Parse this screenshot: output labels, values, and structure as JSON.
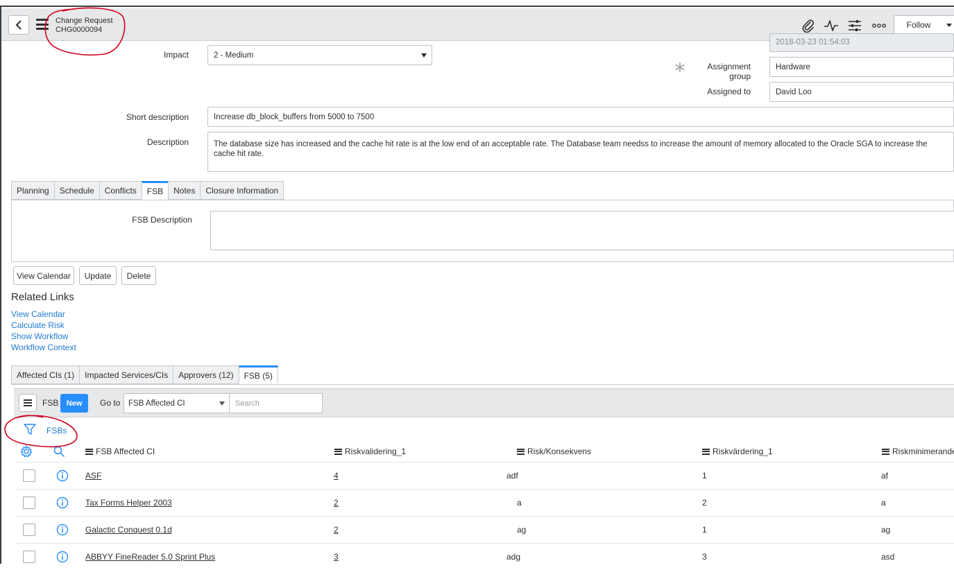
{
  "header": {
    "title": "Change Request",
    "number": "CHG0000094",
    "follow_label": "Follow"
  },
  "form": {
    "impact_label": "Impact",
    "impact_value": "2 - Medium",
    "conflict_last_run_value": "2018-03-23 01:54:03",
    "assignment_group_label": "Assignment group",
    "assignment_group_value": "Hardware",
    "assigned_to_label": "Assigned to",
    "assigned_to_value": "David Loo",
    "short_description_label": "Short description",
    "short_description_value": "Increase db_block_buffers from 5000 to 7500",
    "description_label": "Description",
    "description_value": "The database size has increased and the cache hit rate is at the low end of an acceptable rate. The Database team needss to increase the amount of memory allocated to the Oracle SGA to increase the cache hit rate."
  },
  "form_tabs": [
    "Planning",
    "Schedule",
    "Conflicts",
    "FSB",
    "Notes",
    "Closure Information"
  ],
  "fsb_panel": {
    "description_label": "FSB Description",
    "description_value": ""
  },
  "actions": {
    "view_calendar": "View Calendar",
    "update": "Update",
    "delete": "Delete"
  },
  "related_links": {
    "title": "Related Links",
    "links": [
      "View Calendar",
      "Calculate Risk",
      "Show Workflow",
      "Workflow Context"
    ]
  },
  "related_tabs": [
    "Affected CIs (1)",
    "Impacted Services/CIs",
    "Approvers (12)",
    "FSB (5)"
  ],
  "list": {
    "table_label": "FSB",
    "new_label": "New",
    "goto_label": "Go to",
    "goto_value": "FSB Affected CI",
    "search_placeholder": "Search",
    "breadcrumb": "FSBs",
    "columns": [
      "FSB Affected CI",
      "Riskvalidering_1",
      "Risk/Konsekvens",
      "Riskvärdering_1",
      "Riskminimerande"
    ],
    "rows": [
      [
        "ASF",
        "4",
        "adf",
        "1",
        "af"
      ],
      [
        "Tax Forms Helper 2003",
        "2",
        "a",
        "2",
        "a"
      ],
      [
        "Galactic Conquest 0.1d",
        "2",
        "ag",
        "1",
        "ag"
      ],
      [
        "ABBYY FineReader 5.0 Sprint Plus",
        "3",
        "adg",
        "3",
        "asd"
      ]
    ]
  },
  "colors": {
    "accent": "#278efc",
    "link": "#1f7ad1",
    "annotation": "#d0021b",
    "header_bg": "#e6e8ea"
  }
}
